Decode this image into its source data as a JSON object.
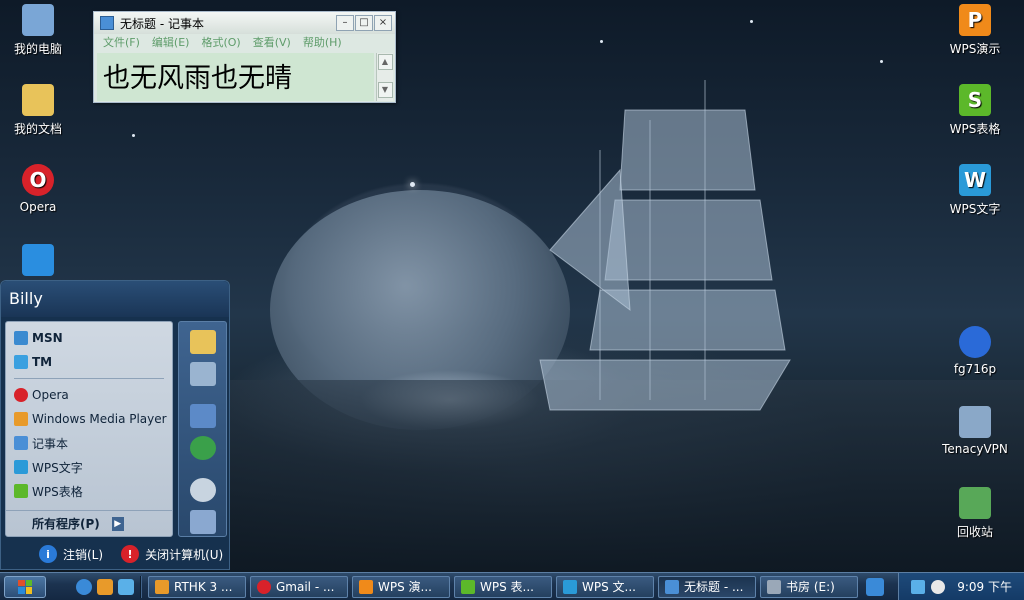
{
  "desktop_left_icons": [
    {
      "label": "我的电脑",
      "icon": "my-computer-icon",
      "color": "#7aa6d6"
    },
    {
      "label": "我的文档",
      "icon": "my-documents-icon",
      "color": "#e8c35a"
    },
    {
      "label": "Opera",
      "icon": "opera-icon",
      "color": "#d8222a"
    },
    {
      "label": "",
      "icon": "bird-app-icon",
      "color": "#2a8ee0"
    }
  ],
  "desktop_right_icons": [
    {
      "label": "WPS演示",
      "icon": "wps-presentation-icon",
      "color": "#f08a1a",
      "glyph": "P"
    },
    {
      "label": "WPS表格",
      "icon": "wps-spreadsheet-icon",
      "color": "#5cb82a",
      "glyph": "S"
    },
    {
      "label": "WPS文字",
      "icon": "wps-writer-icon",
      "color": "#2a9ad8",
      "glyph": "W"
    },
    {
      "label": "fg716p",
      "icon": "fg716p-icon",
      "color": "#2a6ad8",
      "glyph": ""
    },
    {
      "label": "TenacyVPN",
      "icon": "tenacyvpn-icon",
      "color": "#8aa8c8",
      "glyph": ""
    },
    {
      "label": "回收站",
      "icon": "recycle-bin-icon",
      "color": "#58a858",
      "glyph": ""
    }
  ],
  "notepad": {
    "title": "无标题 - 记事本",
    "menu": [
      "文件(F)",
      "编辑(E)",
      "格式(O)",
      "查看(V)",
      "帮助(H)"
    ],
    "content": "也无风雨也无晴",
    "buttons": {
      "minimize": "–",
      "maximize": "□",
      "close": "×"
    },
    "scroll_up": "▲",
    "scroll_down": "▼"
  },
  "start_menu": {
    "user": "Billy",
    "pinned": [
      {
        "label": "MSN",
        "icon": "msn-icon",
        "color": "#3a8ad0"
      },
      {
        "label": "TM",
        "icon": "tm-icon",
        "color": "#3aa0e0"
      }
    ],
    "recent": [
      {
        "label": "Opera",
        "icon": "opera-icon",
        "color": "#d8222a"
      },
      {
        "label": "Windows Media Player",
        "icon": "media-player-icon",
        "color": "#e89a2a"
      },
      {
        "label": "记事本",
        "icon": "notepad-icon",
        "color": "#4a8fd6"
      },
      {
        "label": "WPS文字",
        "icon": "wps-writer-icon",
        "color": "#2a9ad8"
      },
      {
        "label": "WPS表格",
        "icon": "wps-spreadsheet-icon",
        "color": "#5cb82a"
      }
    ],
    "all_programs": "所有程序(P)",
    "right_icons": [
      "folder-icon",
      "computer-icon",
      "control-panel-icon",
      "network-icon",
      "search-icon",
      "run-icon"
    ],
    "logoff": "注销(L)",
    "shutdown": "关闭计算机(U)"
  },
  "taskbar": {
    "tasks": [
      {
        "label": "RTHK 3 ...",
        "icon": "media-player-icon",
        "color": "#e89a2a"
      },
      {
        "label": "Gmail - ...",
        "icon": "opera-icon",
        "color": "#d8222a"
      },
      {
        "label": "WPS 演...",
        "icon": "wps-presentation-icon",
        "color": "#f08a1a"
      },
      {
        "label": "WPS 表...",
        "icon": "wps-spreadsheet-icon",
        "color": "#5cb82a"
      },
      {
        "label": "WPS 文...",
        "icon": "wps-writer-icon",
        "color": "#2a9ad8"
      },
      {
        "label": "无标题 - ...",
        "icon": "notepad-icon",
        "color": "#4a8fd6"
      },
      {
        "label": "书房 (E:)",
        "icon": "drive-icon",
        "color": "#9aa8b8"
      }
    ],
    "clock": "9:09 下午"
  }
}
